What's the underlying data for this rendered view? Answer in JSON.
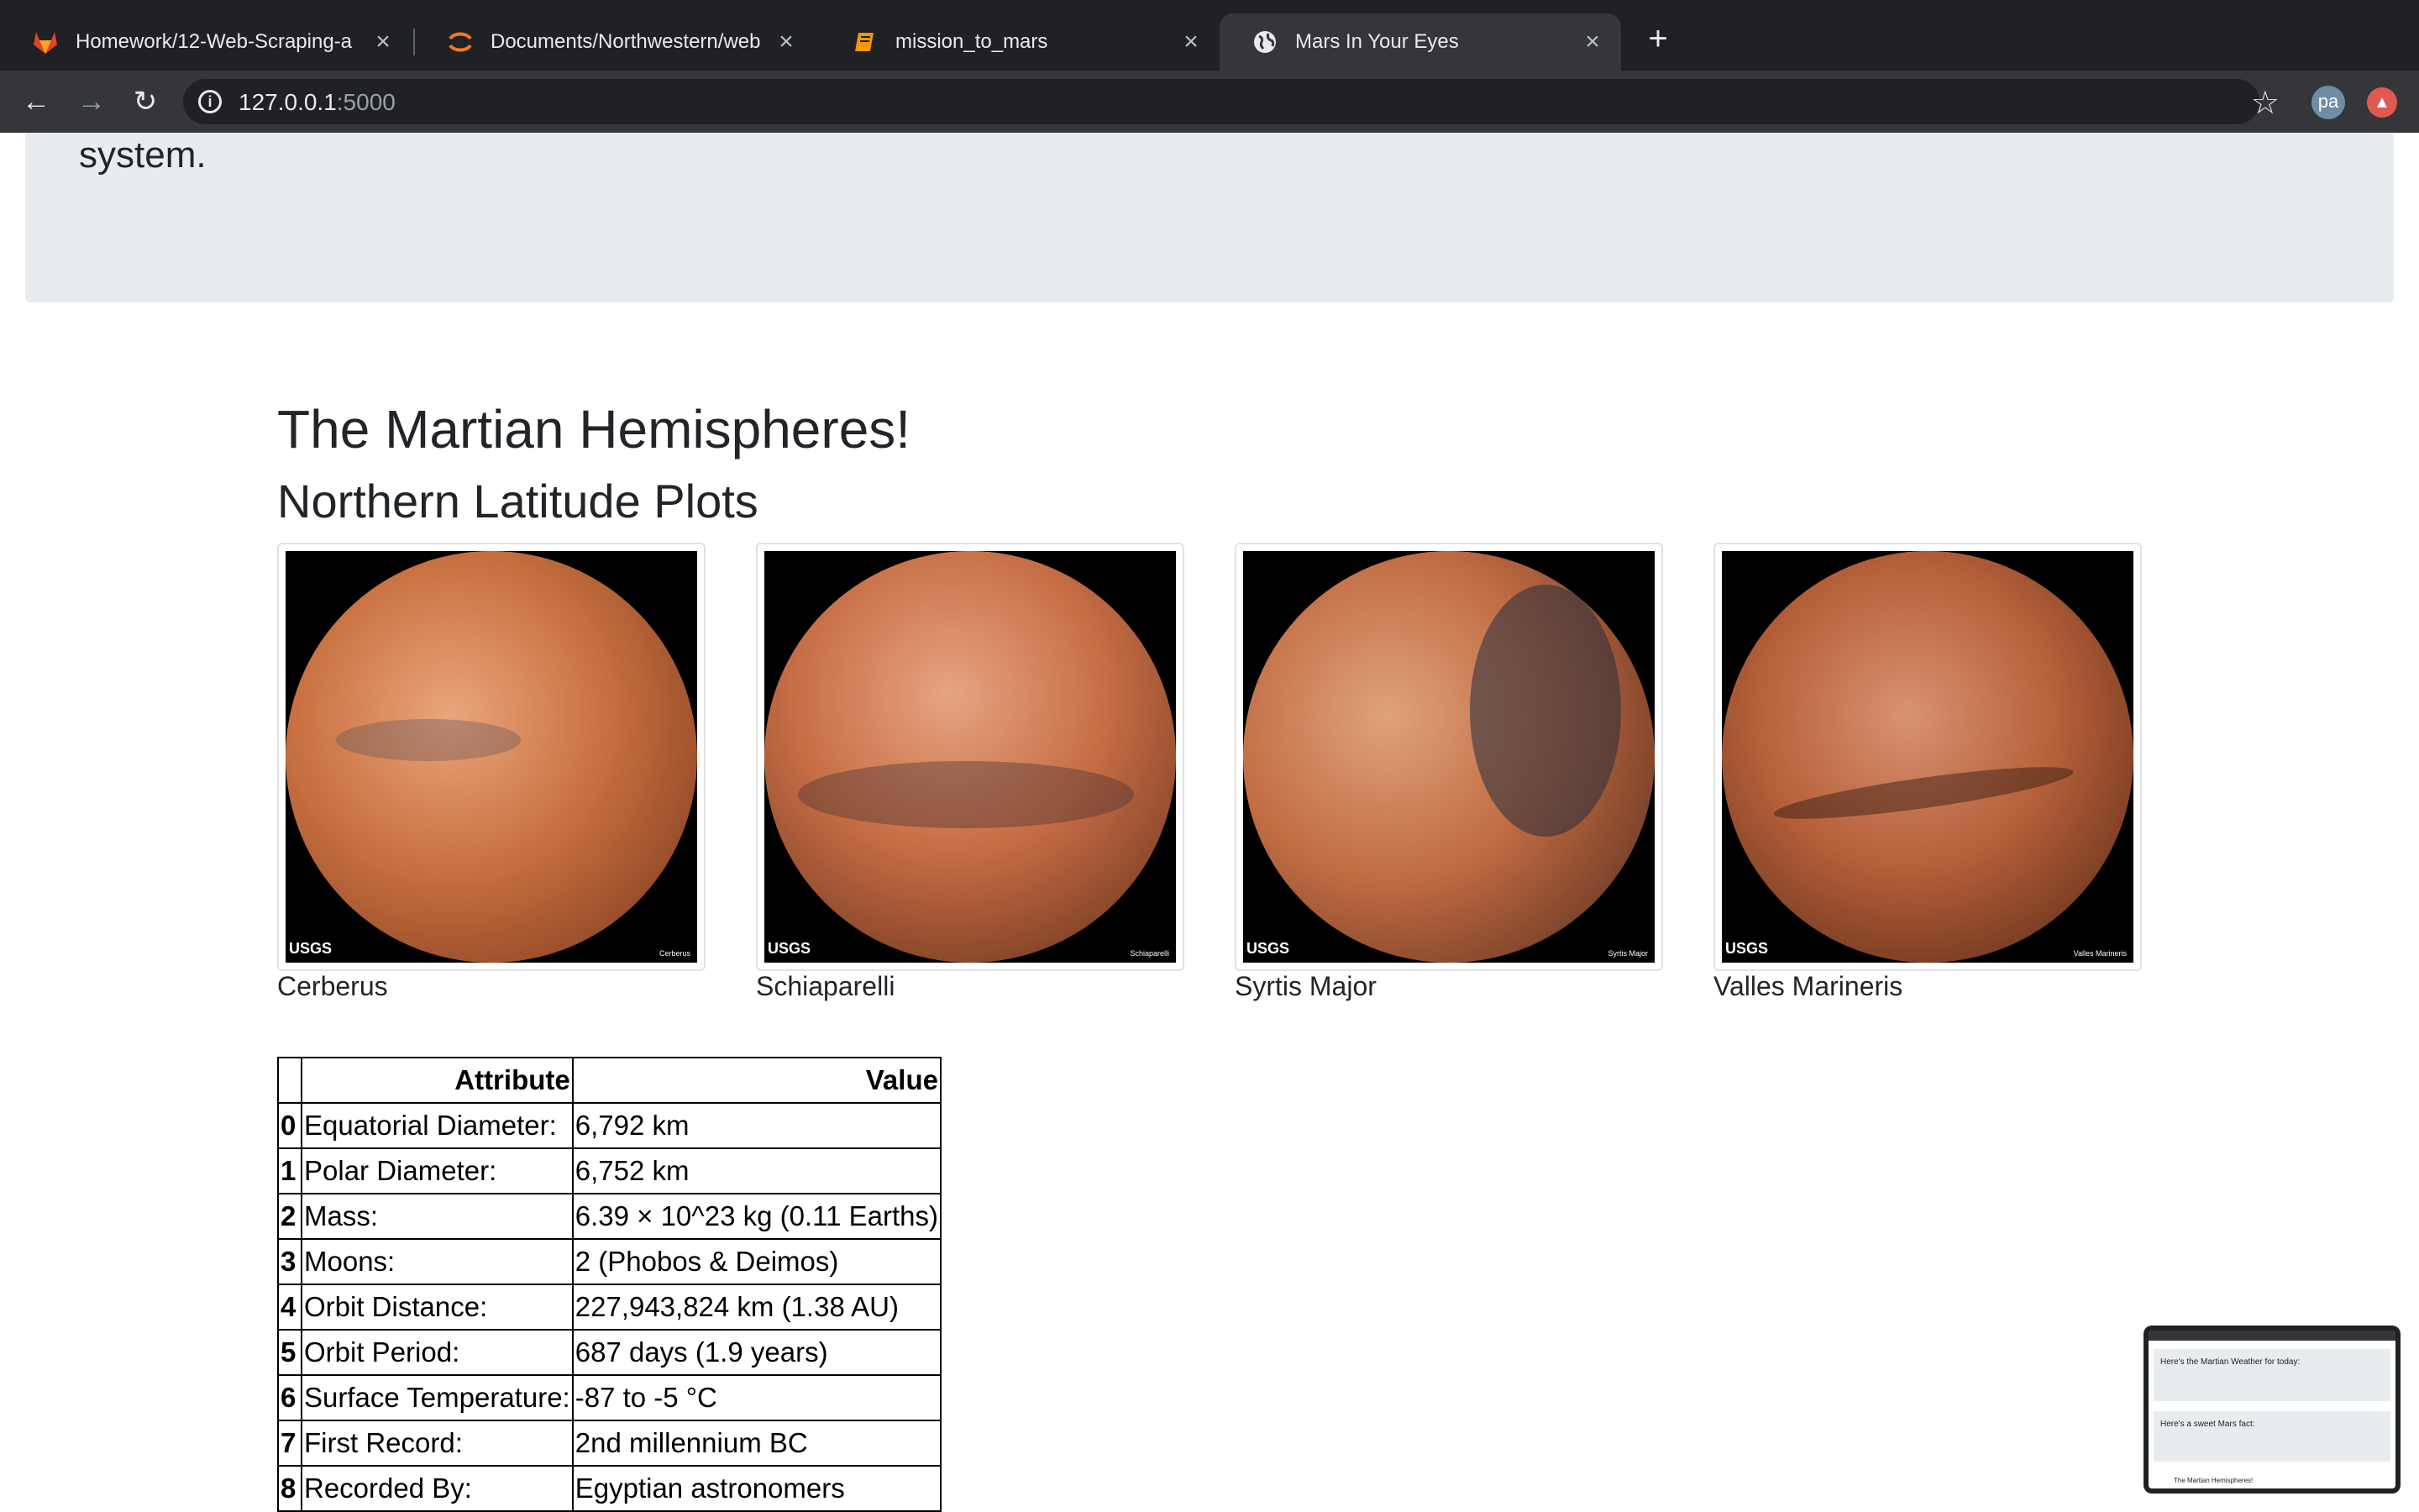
{
  "browser": {
    "tabs": [
      {
        "title": "Homework/12-Web-Scraping-a",
        "icon": "gitlab-icon",
        "active": false
      },
      {
        "title": "Documents/Northwestern/web",
        "icon": "jupyter-icon",
        "active": false
      },
      {
        "title": "mission_to_mars",
        "icon": "notebook-icon",
        "active": false
      },
      {
        "title": "Mars In Your Eyes",
        "icon": "globe-icon",
        "active": true
      }
    ],
    "url_host": "127.0.0.1",
    "url_port": ":5000",
    "profile_initials": "pa"
  },
  "page": {
    "jumbotron_tail": "system.",
    "hemispheres_title": "The Martian Hemispheres!",
    "hemispheres_subtitle": "Northern Latitude Plots",
    "hemispheres": [
      {
        "name": "Cerberus",
        "logo": "USGS",
        "image_label": "Cerberus"
      },
      {
        "name": "Schiaparelli",
        "logo": "USGS",
        "image_label": "Schiaparelli"
      },
      {
        "name": "Syrtis Major",
        "logo": "USGS",
        "image_label": "Syrtis Major"
      },
      {
        "name": "Valles Marineris",
        "logo": "USGS",
        "image_label": "Valles Marineris"
      }
    ],
    "facts_table": {
      "headers": [
        "",
        "Attribute",
        "Value"
      ],
      "rows": [
        {
          "index": "0",
          "attribute": "Equatorial Diameter:",
          "value": "6,792 km"
        },
        {
          "index": "1",
          "attribute": "Polar Diameter:",
          "value": "6,752 km"
        },
        {
          "index": "2",
          "attribute": "Mass:",
          "value": "6.39 × 10^23 kg (0.11 Earths)"
        },
        {
          "index": "3",
          "attribute": "Moons:",
          "value": "2 (Phobos & Deimos)"
        },
        {
          "index": "4",
          "attribute": "Orbit Distance:",
          "value": "227,943,824 km (1.38 AU)"
        },
        {
          "index": "5",
          "attribute": "Orbit Period:",
          "value": "687 days (1.9 years)"
        },
        {
          "index": "6",
          "attribute": "Surface Temperature:",
          "value": "-87 to -5 °C"
        },
        {
          "index": "7",
          "attribute": "First Record:",
          "value": "2nd millennium BC"
        },
        {
          "index": "8",
          "attribute": "Recorded By:",
          "value": "Egyptian astronomers"
        }
      ]
    }
  },
  "preview": {
    "weather_heading": "Here's the Martian Weather for today:",
    "fact_heading": "Here's a sweet Mars fact:",
    "hemis_heading": "The Martian Hemispheres!"
  },
  "colors": {
    "tabbar": "#202124",
    "toolbar": "#35363a",
    "jumbotron": "#e9ecef",
    "mars_orange": "#c8703f"
  }
}
